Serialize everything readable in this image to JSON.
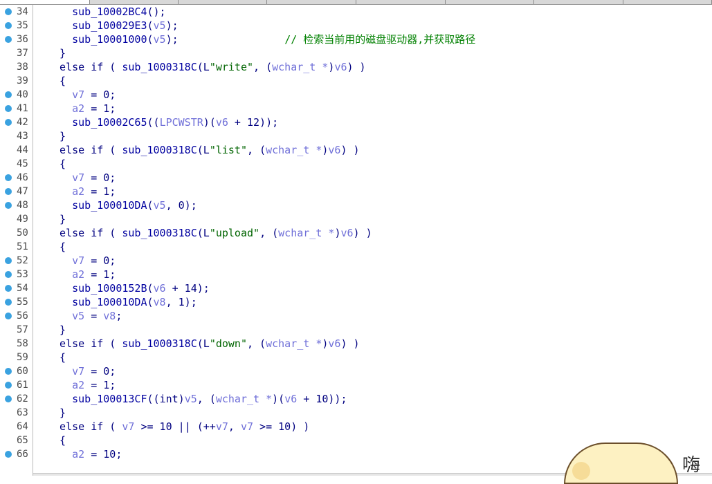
{
  "tabs": [
    "",
    "",
    "",
    "",
    "",
    "",
    "",
    ""
  ],
  "lines": [
    {
      "num": "34",
      "bp": true,
      "parts": [
        [
          "fn",
          "    sub_10002BC4"
        ],
        [
          "plain",
          "();"
        ]
      ]
    },
    {
      "num": "35",
      "bp": true,
      "parts": [
        [
          "fn",
          "    sub_100029E3"
        ],
        [
          "plain",
          "("
        ],
        [
          "var",
          "v5"
        ],
        [
          "plain",
          ");"
        ]
      ]
    },
    {
      "num": "36",
      "bp": true,
      "parts": [
        [
          "fn",
          "    sub_10001000"
        ],
        [
          "plain",
          "("
        ],
        [
          "var",
          "v5"
        ],
        [
          "plain",
          ");                 "
        ],
        [
          "cmt",
          "// 检索当前用的磁盘驱动器,并获取路径"
        ]
      ]
    },
    {
      "num": "37",
      "bp": false,
      "parts": [
        [
          "plain",
          "  }"
        ]
      ]
    },
    {
      "num": "38",
      "bp": false,
      "parts": [
        [
          "kw",
          "  else if ( "
        ],
        [
          "fn",
          "sub_1000318C"
        ],
        [
          "plain",
          "(L"
        ],
        [
          "str",
          "\"write\""
        ],
        [
          "plain",
          ", ("
        ],
        [
          "var",
          "wchar_t *"
        ],
        [
          "plain",
          ")"
        ],
        [
          "var",
          "v6"
        ],
        [
          "plain",
          ") )"
        ]
      ]
    },
    {
      "num": "39",
      "bp": false,
      "parts": [
        [
          "plain",
          "  {"
        ]
      ]
    },
    {
      "num": "40",
      "bp": true,
      "parts": [
        [
          "var",
          "    v7"
        ],
        [
          "plain",
          " = 0;"
        ]
      ]
    },
    {
      "num": "41",
      "bp": true,
      "parts": [
        [
          "var",
          "    a2"
        ],
        [
          "plain",
          " = 1;"
        ]
      ]
    },
    {
      "num": "42",
      "bp": true,
      "parts": [
        [
          "fn",
          "    sub_10002C65"
        ],
        [
          "plain",
          "(("
        ],
        [
          "var",
          "LPCWSTR"
        ],
        [
          "plain",
          ")("
        ],
        [
          "var",
          "v6"
        ],
        [
          "plain",
          " + 12));"
        ]
      ]
    },
    {
      "num": "43",
      "bp": false,
      "parts": [
        [
          "plain",
          "  }"
        ]
      ]
    },
    {
      "num": "44",
      "bp": false,
      "parts": [
        [
          "kw",
          "  else if ( "
        ],
        [
          "fn",
          "sub_1000318C"
        ],
        [
          "plain",
          "(L"
        ],
        [
          "str",
          "\"list\""
        ],
        [
          "plain",
          ", ("
        ],
        [
          "var",
          "wchar_t *"
        ],
        [
          "plain",
          ")"
        ],
        [
          "var",
          "v6"
        ],
        [
          "plain",
          ") )"
        ]
      ]
    },
    {
      "num": "45",
      "bp": false,
      "parts": [
        [
          "plain",
          "  {"
        ]
      ]
    },
    {
      "num": "46",
      "bp": true,
      "parts": [
        [
          "var",
          "    v7"
        ],
        [
          "plain",
          " = 0;"
        ]
      ]
    },
    {
      "num": "47",
      "bp": true,
      "parts": [
        [
          "var",
          "    a2"
        ],
        [
          "plain",
          " = 1;"
        ]
      ]
    },
    {
      "num": "48",
      "bp": true,
      "parts": [
        [
          "fn",
          "    sub_100010DA"
        ],
        [
          "plain",
          "("
        ],
        [
          "var",
          "v5"
        ],
        [
          "plain",
          ", 0);"
        ]
      ]
    },
    {
      "num": "49",
      "bp": false,
      "parts": [
        [
          "plain",
          "  }"
        ]
      ]
    },
    {
      "num": "50",
      "bp": false,
      "parts": [
        [
          "kw",
          "  else if ( "
        ],
        [
          "fn",
          "sub_1000318C"
        ],
        [
          "plain",
          "(L"
        ],
        [
          "str",
          "\"upload\""
        ],
        [
          "plain",
          ", ("
        ],
        [
          "var",
          "wchar_t *"
        ],
        [
          "plain",
          ")"
        ],
        [
          "var",
          "v6"
        ],
        [
          "plain",
          ") )"
        ]
      ]
    },
    {
      "num": "51",
      "bp": false,
      "parts": [
        [
          "plain",
          "  {"
        ]
      ]
    },
    {
      "num": "52",
      "bp": true,
      "parts": [
        [
          "var",
          "    v7"
        ],
        [
          "plain",
          " = 0;"
        ]
      ]
    },
    {
      "num": "53",
      "bp": true,
      "parts": [
        [
          "var",
          "    a2"
        ],
        [
          "plain",
          " = 1;"
        ]
      ]
    },
    {
      "num": "54",
      "bp": true,
      "parts": [
        [
          "fn",
          "    sub_1000152B"
        ],
        [
          "plain",
          "("
        ],
        [
          "var",
          "v6"
        ],
        [
          "plain",
          " + 14);"
        ]
      ]
    },
    {
      "num": "55",
      "bp": true,
      "parts": [
        [
          "fn",
          "    sub_100010DA"
        ],
        [
          "plain",
          "("
        ],
        [
          "var",
          "v8"
        ],
        [
          "plain",
          ", 1);"
        ]
      ]
    },
    {
      "num": "56",
      "bp": true,
      "parts": [
        [
          "var",
          "    v5"
        ],
        [
          "plain",
          " = "
        ],
        [
          "var",
          "v8"
        ],
        [
          "plain",
          ";"
        ]
      ]
    },
    {
      "num": "57",
      "bp": false,
      "parts": [
        [
          "plain",
          "  }"
        ]
      ]
    },
    {
      "num": "58",
      "bp": false,
      "parts": [
        [
          "kw",
          "  else if ( "
        ],
        [
          "fn",
          "sub_1000318C"
        ],
        [
          "plain",
          "(L"
        ],
        [
          "str",
          "\"down\""
        ],
        [
          "plain",
          ", ("
        ],
        [
          "var",
          "wchar_t *"
        ],
        [
          "plain",
          ")"
        ],
        [
          "var",
          "v6"
        ],
        [
          "plain",
          ") )"
        ]
      ]
    },
    {
      "num": "59",
      "bp": false,
      "parts": [
        [
          "plain",
          "  {"
        ]
      ]
    },
    {
      "num": "60",
      "bp": true,
      "parts": [
        [
          "var",
          "    v7"
        ],
        [
          "plain",
          " = 0;"
        ]
      ]
    },
    {
      "num": "61",
      "bp": true,
      "parts": [
        [
          "var",
          "    a2"
        ],
        [
          "plain",
          " = 1;"
        ]
      ]
    },
    {
      "num": "62",
      "bp": true,
      "parts": [
        [
          "fn",
          "    sub_100013CF"
        ],
        [
          "plain",
          "(("
        ],
        [
          "kw",
          "int"
        ],
        [
          "plain",
          ")"
        ],
        [
          "var",
          "v5"
        ],
        [
          "plain",
          ", ("
        ],
        [
          "var",
          "wchar_t *"
        ],
        [
          "plain",
          ")("
        ],
        [
          "var",
          "v6"
        ],
        [
          "plain",
          " + 10));"
        ]
      ]
    },
    {
      "num": "63",
      "bp": false,
      "parts": [
        [
          "plain",
          "  }"
        ]
      ]
    },
    {
      "num": "64",
      "bp": false,
      "parts": [
        [
          "kw",
          "  else if ( "
        ],
        [
          "var",
          "v7"
        ],
        [
          "plain",
          " >= 10 || (++"
        ],
        [
          "var",
          "v7"
        ],
        [
          "plain",
          ", "
        ],
        [
          "var",
          "v7"
        ],
        [
          "plain",
          " >= 10) )"
        ]
      ]
    },
    {
      "num": "65",
      "bp": false,
      "parts": [
        [
          "plain",
          "  {"
        ]
      ]
    },
    {
      "num": "66",
      "bp": true,
      "parts": [
        [
          "var",
          "    a2"
        ],
        [
          "plain",
          " = 10;"
        ]
      ]
    }
  ],
  "colors": {
    "function": "#0000a0",
    "keyword": "#000080",
    "variable": "#6f6fd8",
    "string": "#006400",
    "comment": "#008000",
    "breakpoint": "#3aa2e0"
  },
  "overlay": {
    "text": "嗨"
  }
}
